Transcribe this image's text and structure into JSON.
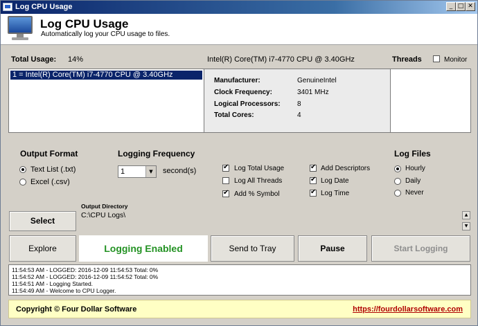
{
  "window": {
    "title": "Log CPU Usage",
    "minimize": "_",
    "maximize": "□",
    "close": "✕"
  },
  "header": {
    "title": "Log CPU Usage",
    "subtitle": "Automatically log your CPU usage to files."
  },
  "usage": {
    "label": "Total Usage:",
    "value": "14%"
  },
  "cpu_name": "Intel(R) Core(TM) i7-4770 CPU @ 3.40GHz",
  "threads": {
    "label": "Threads",
    "monitor_label": "Monitor",
    "monitor_checked": false
  },
  "processor_list": [
    "1 = Intel(R) Core(TM) i7-4770 CPU @ 3.40GHz"
  ],
  "info": {
    "manufacturer_label": "Manufacturer:",
    "manufacturer": "GenuineIntel",
    "clock_label": "Clock Frequency:",
    "clock": "3401 MHz",
    "logical_label": "Logical Processors:",
    "logical": "8",
    "cores_label": "Total Cores:",
    "cores": "4"
  },
  "output_format": {
    "heading": "Output Format",
    "txt": "Text List (.txt)",
    "csv": "Excel (.csv)",
    "selected": "txt"
  },
  "logging_frequency": {
    "heading": "Logging Frequency",
    "value": "1",
    "unit": "second(s)"
  },
  "options": {
    "log_total_usage": {
      "label": "Log Total Usage",
      "checked": true
    },
    "log_all_threads": {
      "label": "Log All Threads",
      "checked": false
    },
    "add_percent": {
      "label": "Add % Symbol",
      "checked": true
    },
    "add_descriptors": {
      "label": "Add Descriptors",
      "checked": true
    },
    "log_date": {
      "label": "Log Date",
      "checked": true
    },
    "log_time": {
      "label": "Log Time",
      "checked": true
    }
  },
  "log_files": {
    "heading": "Log Files",
    "hourly": "Hourly",
    "daily": "Daily",
    "never": "Never",
    "selected": "hourly"
  },
  "output_directory": {
    "label": "Output Directory",
    "path": "C:\\CPU Logs\\"
  },
  "buttons": {
    "select": "Select",
    "explore": "Explore",
    "status": "Logging Enabled",
    "send_to_tray": "Send to Tray",
    "pause": "Pause",
    "start_logging": "Start Logging"
  },
  "log": [
    "11:54:53 AM - LOGGED: 2016-12-09 11:54:53 Total: 0%",
    "11:54:52 AM - LOGGED: 2016-12-09 11:54:52 Total: 0%",
    "11:54:51 AM - Logging Started.",
    "11:54:49 AM - Welcome to CPU Logger."
  ],
  "footer": {
    "copyright": "Copyright © Four Dollar Software",
    "link": "https://fourdollarsoftware.com"
  },
  "colors": {
    "titlebar": "#0a246a",
    "status_green": "#239223",
    "footer_bg": "#ffffc4",
    "link_red": "#b00000"
  }
}
